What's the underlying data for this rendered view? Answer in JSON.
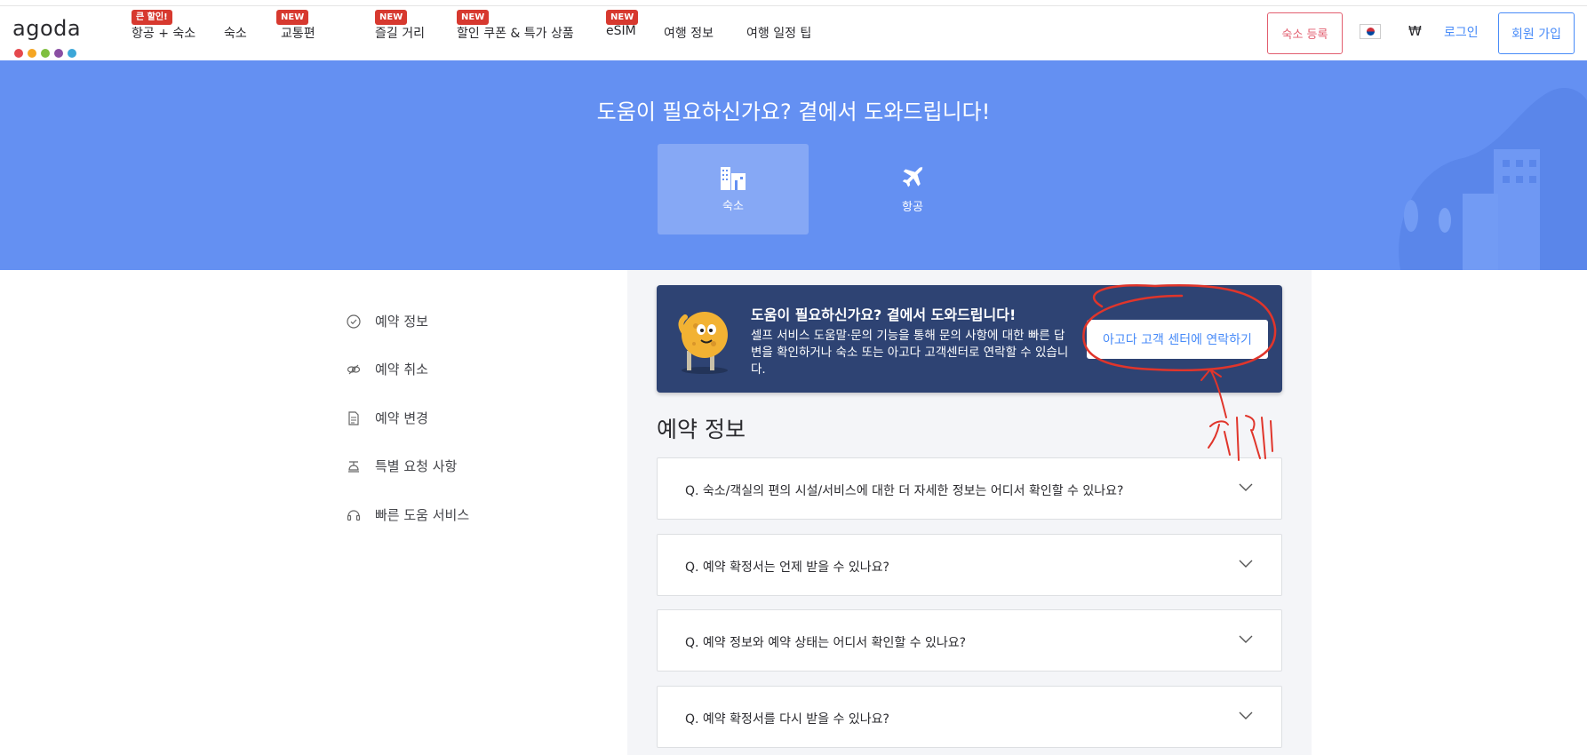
{
  "nav": {
    "logo_text": "agoda",
    "logo_colors": [
      "#e5484d",
      "#f5a623",
      "#7fbf3f",
      "#8a4ea3",
      "#3ca7d8"
    ],
    "items": [
      {
        "label": "항공 + 숙소",
        "badge": "큰 할인!"
      },
      {
        "label": "숙소",
        "badge": ""
      },
      {
        "label": "교통편",
        "badge": "NEW"
      },
      {
        "label": "즐길 거리",
        "badge": "NEW"
      },
      {
        "label": "할인 쿠폰 & 특가 상품",
        "badge": "NEW"
      },
      {
        "label": "eSIM",
        "badge": "NEW"
      },
      {
        "label": "여행 정보",
        "badge": ""
      },
      {
        "label": "여행 일정 팁",
        "badge": ""
      }
    ],
    "register_label": "숙소 등록",
    "currency": "₩",
    "login_label": "로그인",
    "signup_label": "회원 가입"
  },
  "hero": {
    "title": "도움이 필요하신가요? 곁에서 도와드립니다!",
    "tabs": [
      {
        "label": "숙소",
        "icon": "hotel-icon",
        "active": true
      },
      {
        "label": "항공",
        "icon": "plane-icon",
        "active": false
      }
    ]
  },
  "sidebar": {
    "items": [
      {
        "label": "예약 정보",
        "icon": "check-circle-icon"
      },
      {
        "label": "예약 취소",
        "icon": "cancel-link-icon"
      },
      {
        "label": "예약 변경",
        "icon": "document-icon"
      },
      {
        "label": "특별 요청 사항",
        "icon": "concierge-icon"
      },
      {
        "label": "빠른 도움 서비스",
        "icon": "headset-icon"
      }
    ]
  },
  "help_card": {
    "title": "도움이 필요하신가요? 곁에서 도와드립니다!",
    "description": "셀프 서비스 도움말·문의 기능을 통해 문의 사항에 대한 빠른 답변을 확인하거나 숙소 또는 아고다 고객센터로 연락할 수 있습니다.",
    "button_label": "아고다 고객 센터에 연락하기"
  },
  "section_title": "예약 정보",
  "faqs": [
    "Q. 숙소/객실의 편의 시설/서비스에 대한 더 자세한 정보는 어디서 확인할 수 있나요?",
    "Q. 예약 확정서는 언제 받을 수 있나요?",
    "Q. 예약 정보와 예약 상태는 어디서 확인할 수 있나요?",
    "Q. 예약 확정서를 다시 받을 수 있나요?"
  ],
  "annotation": {
    "handwritten_text": "클릭",
    "color": "#e0352b"
  },
  "colors": {
    "hero_bg": "#6490f2",
    "card_bg": "#2e4373",
    "accent_blue": "#488bf8",
    "accent_red": "#e25e6f",
    "badge_red": "#d7392f"
  }
}
